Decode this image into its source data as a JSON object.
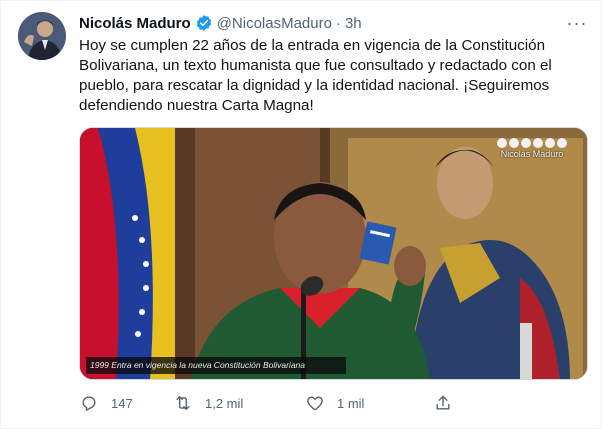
{
  "tweet": {
    "author_name": "Nicolás Maduro",
    "handle": "@NicolasMaduro",
    "separator": "·",
    "time": "3h",
    "more_label": "···",
    "text_lines": [
      "Hoy se cumplen 22 años de la entrada en vigencia de la Constitución",
      "Bolivariana, un texto humanista que fue consultado y redactado con el",
      "pueblo, para rescatar la dignidad y la identidad nacional. ¡Seguiremos",
      "defendiendo nuestra Carta Magna!"
    ],
    "media": {
      "caption": "1999 Entra en vigencia la nueva Constitución Bolivariana",
      "watermark": "Nicolás Maduro"
    },
    "actions": {
      "reply_count": "147",
      "retweet_count": "1,2 mil",
      "like_count": "1 mil"
    }
  },
  "colors": {
    "text": "#0f1419",
    "secondary": "#536471",
    "verified": "#1d9bf0",
    "border": "#cfd9de"
  },
  "icons": [
    "verified-badge-icon",
    "more-icon",
    "reply-icon",
    "retweet-icon",
    "like-icon",
    "share-icon"
  ]
}
